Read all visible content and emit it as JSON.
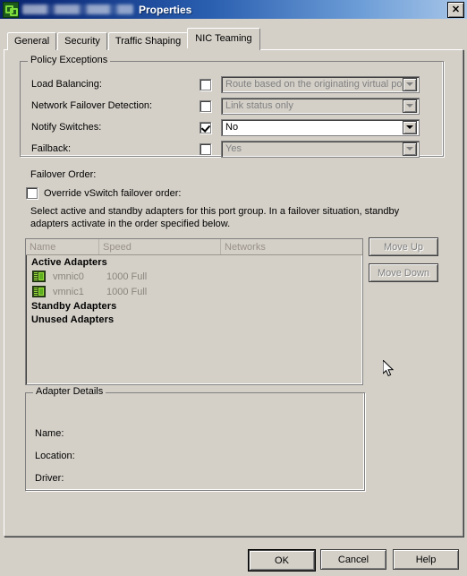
{
  "window": {
    "title": "Properties",
    "title_prefix_redacted": true,
    "close_label": "✕",
    "icon": "vswitch-icon"
  },
  "tabs": [
    {
      "label": "General",
      "active": false
    },
    {
      "label": "Security",
      "active": false
    },
    {
      "label": "Traffic Shaping",
      "active": false
    },
    {
      "label": "NIC Teaming",
      "active": true
    }
  ],
  "policy_exceptions": {
    "legend": "Policy Exceptions",
    "rows": [
      {
        "label": "Load Balancing:",
        "checked": false,
        "enabled": false,
        "value": "Route based on the originating virtual port ID"
      },
      {
        "label": "Network Failover Detection:",
        "checked": false,
        "enabled": false,
        "value": "Link status only"
      },
      {
        "label": "Notify Switches:",
        "checked": true,
        "enabled": true,
        "value": "No"
      },
      {
        "label": "Failback:",
        "checked": false,
        "enabled": false,
        "value": "Yes"
      }
    ]
  },
  "failover_order": {
    "title": "Failover Order:",
    "override_label": "Override vSwitch failover order:",
    "override_checked": false,
    "description": "Select active and standby adapters for this port group.  In a failover situation, standby adapters activate  in the order specified below."
  },
  "adapter_list": {
    "columns": [
      "Name",
      "Speed",
      "Networks"
    ],
    "groups": [
      {
        "title": "Active Adapters",
        "rows": [
          {
            "name": "vmnic0",
            "speed": "1000 Full",
            "networks_redacted": true
          },
          {
            "name": "vmnic1",
            "speed": "1000 Full",
            "networks_redacted": true
          }
        ]
      },
      {
        "title": "Standby Adapters",
        "rows": []
      },
      {
        "title": "Unused Adapters",
        "rows": []
      }
    ]
  },
  "order_buttons": [
    {
      "label": "Move Up",
      "enabled": false
    },
    {
      "label": "Move Down",
      "enabled": false
    }
  ],
  "adapter_details": {
    "legend": "Adapter Details",
    "fields": [
      {
        "label": "Name:",
        "value": ""
      },
      {
        "label": "Location:",
        "value": ""
      },
      {
        "label": "Driver:",
        "value": ""
      }
    ]
  },
  "dialog_buttons": [
    {
      "label": "OK",
      "default": true
    },
    {
      "label": "Cancel",
      "default": false
    },
    {
      "label": "Help",
      "default": false
    }
  ],
  "colors": {
    "window_background": "#d4d0c8",
    "titlebar_start": "#0a246a",
    "titlebar_end": "#a8c6e8",
    "disabled_text": "#808080",
    "list_header_text": "#999188"
  }
}
